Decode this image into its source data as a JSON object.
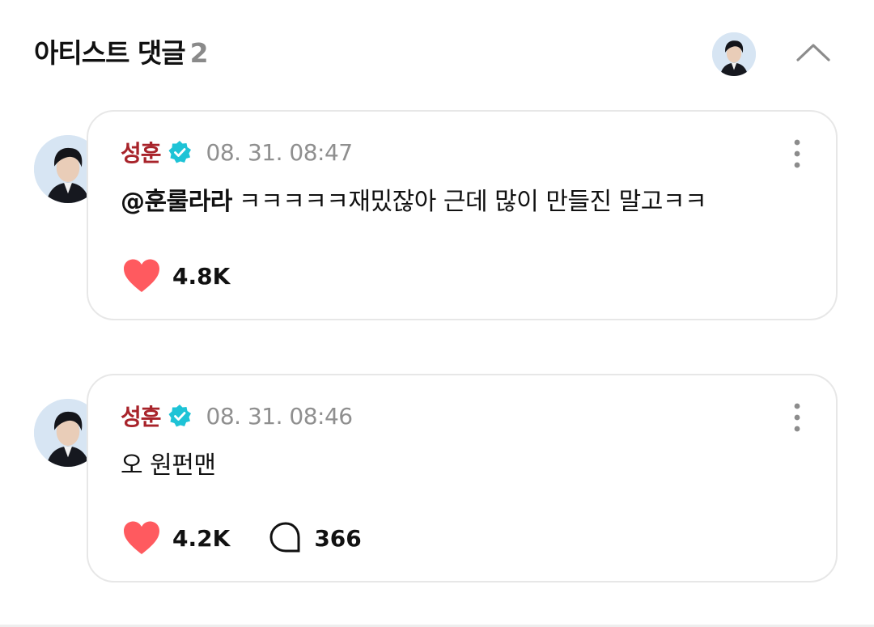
{
  "header": {
    "title": "아티스트 댓글",
    "count": "2"
  },
  "comments": [
    {
      "author": "성훈",
      "time": "08. 31. 08:47",
      "mention": "@훈룰라라",
      "text": "ㅋㅋㅋㅋㅋ재밌잖아 근데 많이 만들진 말고ㅋㅋ",
      "likes": "4.8K",
      "replies": ""
    },
    {
      "author": "성훈",
      "time": "08. 31. 08:46",
      "mention": "",
      "text": "오 원펀맨",
      "likes": "4.2K",
      "replies": "366"
    }
  ],
  "colors": {
    "author": "#a8232a",
    "verified": "#1ec3d6",
    "heart": "#ff5a5f",
    "timestamp": "#8f8f8f",
    "card_border": "#e7e7e7"
  },
  "icons": [
    "avatar",
    "verified-badge-icon",
    "chevron-up-icon",
    "more-vertical-icon",
    "heart-icon",
    "comment-bubble-icon"
  ]
}
